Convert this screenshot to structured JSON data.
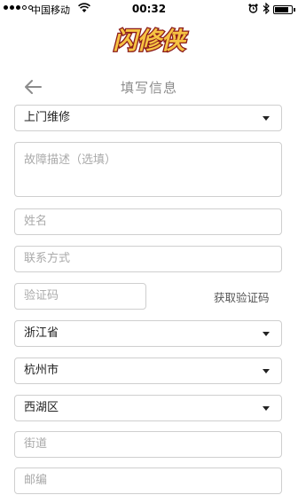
{
  "status_bar": {
    "carrier": "中国移动",
    "time": "00:32",
    "icons": [
      "signal-dots",
      "wifi-icon",
      "alarm-icon",
      "bluetooth-icon",
      "battery-icon"
    ]
  },
  "logo": {
    "text": "闪修侠",
    "colors": {
      "fill": "#f6c343",
      "outline": "#8b1a1a"
    }
  },
  "header": {
    "title": "填写信息",
    "back_icon": "back-arrow-icon"
  },
  "form": {
    "service_type": {
      "value": "上门维修"
    },
    "fault_description": {
      "placeholder": "故障描述（选填）"
    },
    "name": {
      "placeholder": "姓名"
    },
    "contact": {
      "placeholder": "联系方式"
    },
    "verify_code": {
      "placeholder": "验证码",
      "get_code_label": "获取验证码"
    },
    "province": {
      "value": "浙江省"
    },
    "city": {
      "value": "杭州市"
    },
    "district": {
      "value": "西湖区"
    },
    "street": {
      "placeholder": "街道"
    },
    "postcode": {
      "placeholder": "邮编"
    }
  }
}
